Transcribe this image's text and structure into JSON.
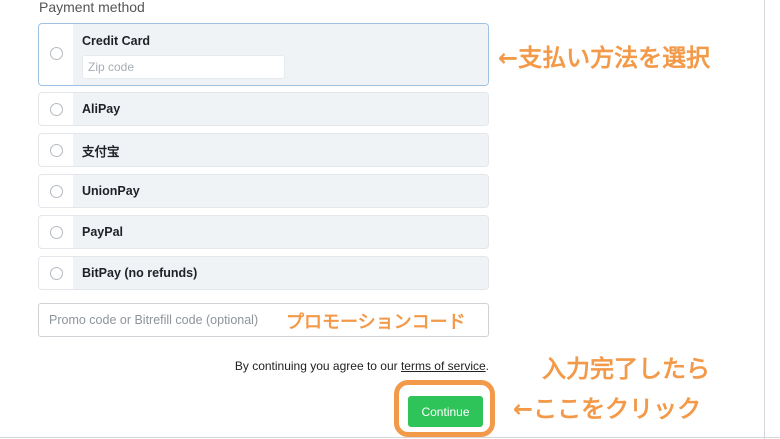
{
  "payment": {
    "title": "Payment method",
    "methods": [
      {
        "label": "Credit Card",
        "selected": true,
        "zip_placeholder": "Zip code"
      },
      {
        "label": "AliPay",
        "selected": false
      },
      {
        "label": "支付宝",
        "selected": false
      },
      {
        "label": "UnionPay",
        "selected": false
      },
      {
        "label": "PayPal",
        "selected": false
      },
      {
        "label": "BitPay (no refunds)",
        "selected": false
      }
    ]
  },
  "promo": {
    "placeholder": "Promo code or Bitrefill code (optional)"
  },
  "terms": {
    "prefix": "By continuing you agree to our ",
    "link": "terms of service",
    "suffix": "."
  },
  "continue_label": "Continue",
  "annotations": {
    "select_method": "←支払い方法を選択",
    "promo_code": "プロモーションコード",
    "when_done": "入力完了したら",
    "click_here": "←ここをクリック"
  },
  "colors": {
    "accent_orange": "#f39a4a",
    "continue_green": "#2fc45a",
    "selected_border": "#9fc2e3"
  }
}
